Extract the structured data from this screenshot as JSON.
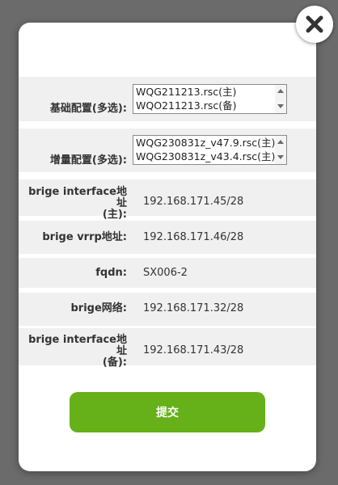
{
  "close": {
    "icon": "close-icon"
  },
  "base_config": {
    "label": "基础配置(多选):",
    "options": [
      "WQG211213.rsc(主)",
      "WQO211213.rsc(备)"
    ]
  },
  "incremental_config": {
    "label": "增量配置(多选):",
    "options": [
      "WQG230831z_v47.9.rsc(主)",
      "WQG230831z_v43.4.rsc(主)"
    ]
  },
  "fields": [
    {
      "label_line1": "brige interface地址",
      "label_line2": "(主):",
      "value": "192.168.171.45/28"
    },
    {
      "label": "brige vrrp地址:",
      "value": "192.168.171.46/28"
    },
    {
      "label": "fqdn:",
      "value": "SX006-2"
    },
    {
      "label": "brige网络:",
      "value": "192.168.171.32/28"
    },
    {
      "label_line1": "brige interface地址",
      "label_line2": "(备):",
      "value": "192.168.171.43/28"
    }
  ],
  "submit": {
    "label": "提交",
    "color": "#66b119"
  },
  "colors": {
    "overlay": "#6b6b6b",
    "row_bg": "#f0f0f0"
  }
}
